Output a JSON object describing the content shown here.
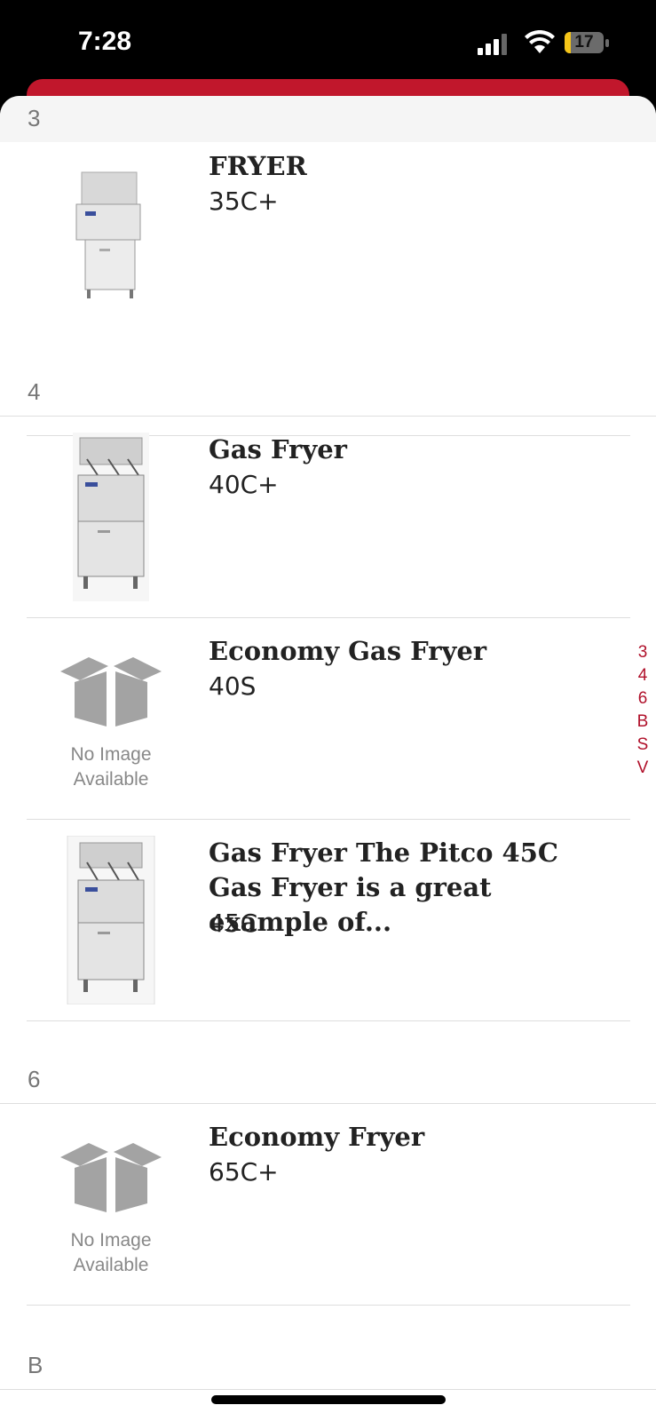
{
  "status": {
    "time": "7:28",
    "battery": "17",
    "battery_level": 0.17
  },
  "colors": {
    "accent": "#c1172c",
    "index": "#b0102a"
  },
  "sections": {
    "s3": "3",
    "s4": "4",
    "s6": "6",
    "sB": "B"
  },
  "products": [
    {
      "title": "FRYER",
      "model": "35C+",
      "image": "fryer-image"
    },
    {
      "title": "Gas Fryer",
      "model": "40C+",
      "image": "gas-fryer-image"
    },
    {
      "title": "Economy Gas Fryer",
      "model": "40S",
      "image": "no-image"
    },
    {
      "title": "Gas Fryer The Pitco 45C Gas Fryer is a great example of...",
      "model": "45C",
      "image": "gas-fryer-image"
    },
    {
      "title": "Economy Fryer",
      "model": "65C+",
      "image": "no-image"
    }
  ],
  "no_image": {
    "line1": "No Image",
    "line2": "Available"
  },
  "index_letters": [
    "3",
    "4",
    "6",
    "B",
    "S",
    "V"
  ]
}
